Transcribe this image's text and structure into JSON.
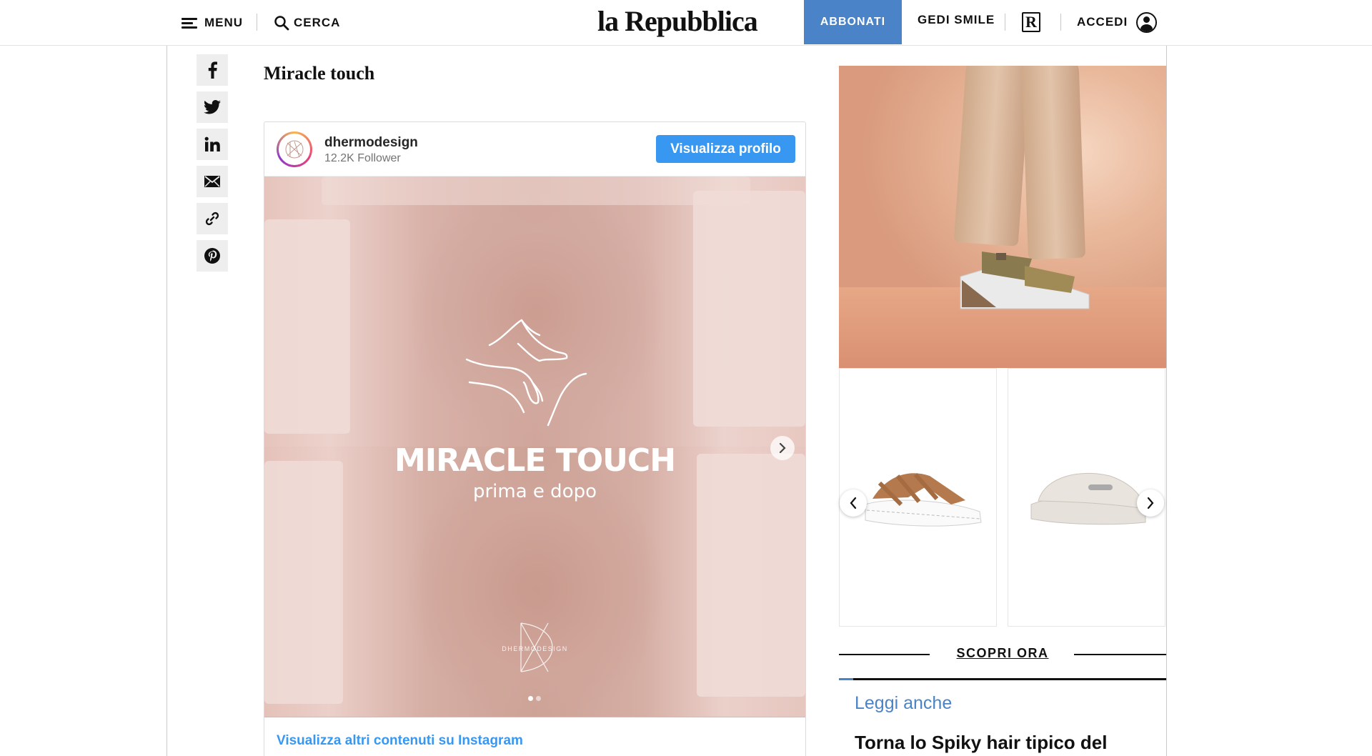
{
  "header": {
    "menu_label": "MENU",
    "search_label": "CERCA",
    "logo_text": "la Repubblica",
    "subscribe_label": "ABBONATI",
    "gedi_label": "GEDI SMILE",
    "r_badge": "R",
    "login_label": "ACCEDI",
    "accent_color": "#4a83c7"
  },
  "share": {
    "icons": [
      "facebook-icon",
      "twitter-icon",
      "linkedin-icon",
      "mail-icon",
      "link-icon",
      "pinterest-icon"
    ]
  },
  "article": {
    "title": "Miracle touch"
  },
  "instagram_embed": {
    "username": "dhermodesign",
    "followers": "12.2K Follower",
    "profile_button": "Visualizza profilo",
    "media_title": "MIRACLE TOUCH",
    "media_subtitle": "prima e dopo",
    "media_brand": "DHERMODESIGN",
    "carousel_position": 1,
    "carousel_total": 2,
    "more_link": "Visualizza altri contenuti su Instagram",
    "button_color": "#3897f0"
  },
  "sidebar_ad": {
    "cta_label": "SCOPRI ORA"
  },
  "leggi_anche": {
    "heading": "Leggi anche",
    "items": [
      "Torna lo Spiky hair tipico del"
    ]
  }
}
